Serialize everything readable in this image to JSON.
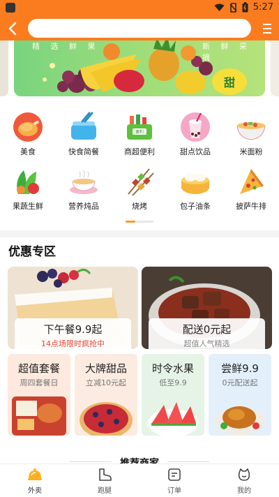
{
  "status_bar": {
    "time": "5:27"
  },
  "search": {
    "placeholder": ""
  },
  "banner": {
    "tagline_left": "精 选 鲜 果",
    "tagline_right": "新 鲜 采 摘",
    "badge": "甜"
  },
  "categories": [
    {
      "label": "美食",
      "icon": "roast-chicken-icon"
    },
    {
      "label": "快食简餐",
      "icon": "fast-meal-bowl-icon"
    },
    {
      "label": "商超便利",
      "icon": "shopping-basket-icon"
    },
    {
      "label": "甜点饮品",
      "icon": "bubble-tea-icon"
    },
    {
      "label": "米面粉",
      "icon": "noodle-bowl-icon"
    },
    {
      "label": "果蔬生鲜",
      "icon": "vegetables-icon"
    },
    {
      "label": "营养炖品",
      "icon": "stew-pot-icon"
    },
    {
      "label": "烧烤",
      "icon": "skewers-icon"
    },
    {
      "label": "包子油条",
      "icon": "steamer-buns-icon"
    },
    {
      "label": "披萨牛排",
      "icon": "pizza-slice-icon"
    }
  ],
  "section_title": "优惠专区",
  "promos": [
    {
      "title": "下午餐9.9起",
      "subtitle": "14点场限时疯抢中",
      "subtitle_color": "#e8453c"
    },
    {
      "title": "配送0元起",
      "subtitle": "超值人气精选",
      "subtitle_color": "#888888"
    }
  ],
  "minis": [
    {
      "title": "超值套餐",
      "subtitle": "周四套餐日",
      "bg": "#fde9dd"
    },
    {
      "title": "大牌甜品",
      "subtitle": "立减10元起",
      "bg": "#fcebe1"
    },
    {
      "title": "时令水果",
      "subtitle": "低至9.9",
      "bg": "#e6f4e7"
    },
    {
      "title": "尝鲜9.9",
      "subtitle": "0元配送起",
      "bg": "#e3f0fb"
    }
  ],
  "recommend_title": "推荐商家",
  "nav": [
    {
      "label": "外卖",
      "icon": "takeout-cloche-icon",
      "active": true
    },
    {
      "label": "跑腿",
      "icon": "errand-boot-icon",
      "active": false
    },
    {
      "label": "订单",
      "icon": "order-list-icon",
      "active": false
    },
    {
      "label": "我的",
      "icon": "profile-face-icon",
      "active": false
    }
  ],
  "colors": {
    "brand": "#fb7c1e",
    "accent_yellow": "#fbb021",
    "price_red": "#e8453c"
  }
}
